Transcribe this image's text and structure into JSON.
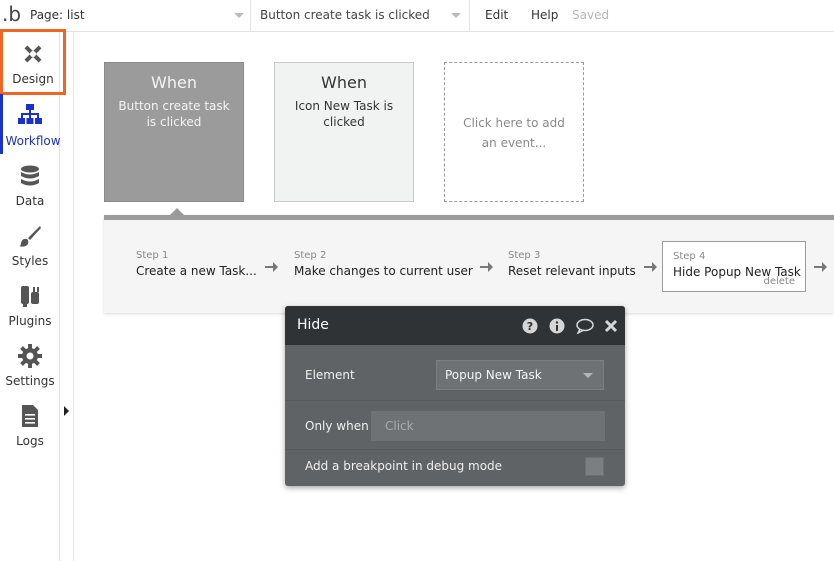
{
  "topbar": {
    "logo": ".b",
    "page_select": "Page: list",
    "event_select": "Button create task is clicked",
    "edit": "Edit",
    "help": "Help",
    "saved": "Saved"
  },
  "sidebar": {
    "items": [
      {
        "label": "Design",
        "icon": "design-icon"
      },
      {
        "label": "Workflow",
        "icon": "workflow-icon"
      },
      {
        "label": "Data",
        "icon": "data-icon"
      },
      {
        "label": "Styles",
        "icon": "styles-icon"
      },
      {
        "label": "Plugins",
        "icon": "plugins-icon"
      },
      {
        "label": "Settings",
        "icon": "settings-icon"
      },
      {
        "label": "Logs",
        "icon": "logs-icon"
      }
    ]
  },
  "events": [
    {
      "when": "When",
      "text": "Button create task is clicked"
    },
    {
      "when": "When",
      "text": "Icon New Task is clicked"
    },
    {
      "text": "Click here to add an event..."
    }
  ],
  "steps": [
    {
      "num": "Step 1",
      "title": "Create a new Task..."
    },
    {
      "num": "Step 2",
      "title": "Make changes to current user"
    },
    {
      "num": "Step 3",
      "title": "Reset relevant inputs"
    },
    {
      "num": "Step 4",
      "title": "Hide Popup New Task",
      "delete": "delete"
    }
  ],
  "panel": {
    "title": "Hide",
    "element_label": "Element",
    "element_value": "Popup New Task",
    "only_when_label": "Only when",
    "only_when_placeholder": "Click",
    "breakpoint_label": "Add a breakpoint in debug mode"
  },
  "colors": {
    "design_highlight": "#f16422",
    "workflow_active": "#1a32c8",
    "panel_bg": "#5f6366",
    "panel_header": "#2f3336"
  }
}
